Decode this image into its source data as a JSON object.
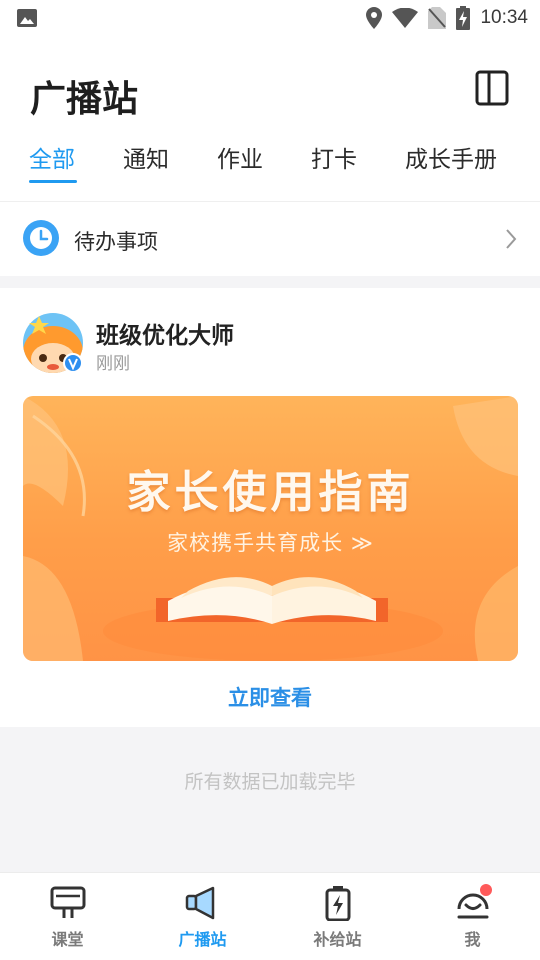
{
  "status_bar": {
    "time": "10:34"
  },
  "header": {
    "title": "广播站"
  },
  "tabs": [
    {
      "label": "全部",
      "active": true
    },
    {
      "label": "通知",
      "active": false
    },
    {
      "label": "作业",
      "active": false
    },
    {
      "label": "打卡",
      "active": false
    },
    {
      "label": "成长手册",
      "active": false
    }
  ],
  "todo": {
    "label": "待办事项"
  },
  "post": {
    "author": "班级优化大师",
    "time": "刚刚",
    "banner": {
      "title": "家长使用指南",
      "subtitle": "家校携手共育成长 ≫"
    },
    "action_label": "立即查看"
  },
  "feed_end_text": "所有数据已加载完毕",
  "bottom_nav": [
    {
      "label": "课堂",
      "icon": "classroom-icon",
      "active": false
    },
    {
      "label": "广播站",
      "icon": "megaphone-icon",
      "active": true
    },
    {
      "label": "补给站",
      "icon": "battery-icon",
      "active": false
    },
    {
      "label": "我",
      "icon": "smile-icon",
      "active": false,
      "badge_dot": true
    }
  ],
  "colors": {
    "accent": "#1f9af0",
    "banner_orange": "#ff9e49",
    "badge_red": "#ff5a5a"
  }
}
